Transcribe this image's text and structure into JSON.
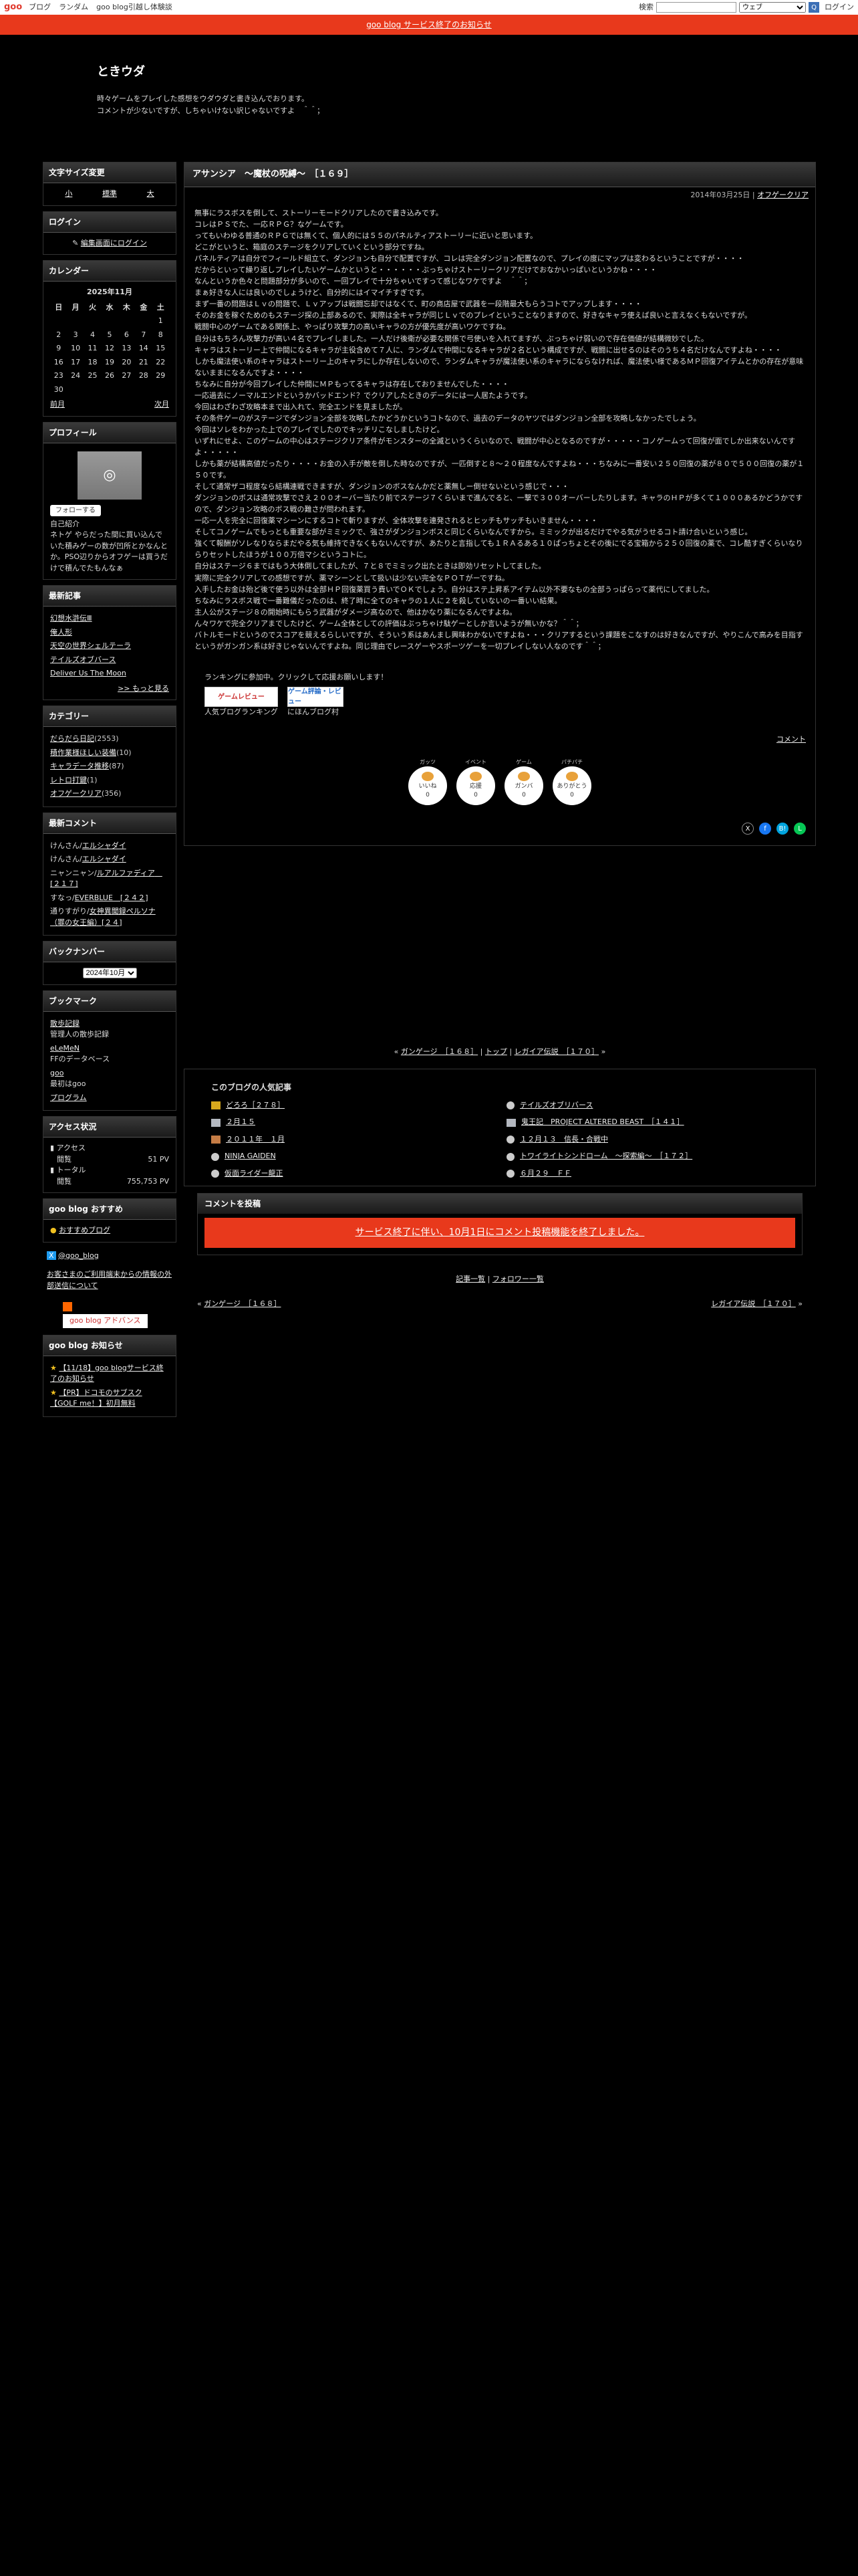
{
  "topbar": {
    "logo": "goo",
    "nav": [
      "ブログ",
      "ランダム",
      "goo blog引越し体験談"
    ],
    "search_label": "検索",
    "search_select": "ウェブ",
    "search_button": "Q",
    "login": "ログイン"
  },
  "notice": {
    "text": "goo blog サービス終了のお知らせ"
  },
  "header": {
    "title": "ときウダ",
    "desc1": "時々ゲームをプレイした感想をウダウダと書き込んでおります。",
    "desc2": "コメントが少ないですが、しちゃいけない訳じゃないですよ　＾＾；"
  },
  "sidebar": {
    "font_title": "文字サイズ変更",
    "font_small": "小",
    "font_mid": "標準",
    "font_large": "大",
    "login_title": "ログイン",
    "login_link": "編集画面にログイン",
    "cal_title": "カレンダー",
    "cal_month": "2025年11月",
    "cal_days": [
      "日",
      "月",
      "火",
      "水",
      "木",
      "金",
      "土"
    ],
    "cal_rows": [
      [
        "",
        "",
        "",
        "",
        "",
        "",
        "1"
      ],
      [
        "2",
        "3",
        "4",
        "5",
        "6",
        "7",
        "8"
      ],
      [
        "9",
        "10",
        "11",
        "12",
        "13",
        "14",
        "15"
      ],
      [
        "16",
        "17",
        "18",
        "19",
        "20",
        "21",
        "22"
      ],
      [
        "23",
        "24",
        "25",
        "26",
        "27",
        "28",
        "29"
      ],
      [
        "30",
        "",
        "",
        "",
        "",
        "",
        ""
      ]
    ],
    "cal_prev": "前月",
    "cal_next": "次月",
    "profile_title": "プロフィール",
    "follow": "フォローする",
    "profile_label": "自己紹介",
    "profile_text": "ネトゲ やらだった間に買い込んでいた積みゲーの数が凹所とかなんとか。PSO辺りからオフゲーは買うだけで積んでたもんなぁ",
    "recent_title": "最新記事",
    "recent": [
      "幻想水滸伝Ⅲ",
      "俺人形",
      "天空の世界シェルテーラ",
      "テイルズオブバース",
      "Deliver Us The Moon"
    ],
    "recent_more": ">> もっと見る",
    "cat_title": "カテゴリー",
    "categories": [
      {
        "name": "だらだら日記",
        "count": "(2553)"
      },
      {
        "name": "積作業様ほしい装備",
        "count": "(10)"
      },
      {
        "name": "キャラデータ推移",
        "count": "(87)"
      },
      {
        "name": "レトロ打鍵",
        "count": "(1)"
      },
      {
        "name": "オフゲークリア",
        "count": "(356)"
      }
    ],
    "comments_title": "最新コメント",
    "comments": [
      {
        "who": "けんさん",
        "post": "エルシャダイ"
      },
      {
        "who": "けんさん",
        "post": "エルシャダイ"
      },
      {
        "who": "ニャンニャン",
        "post": "ルアルファディア　[２１７]"
      },
      {
        "who": "すなっ",
        "post": "EVERBLUE　[２４２]"
      },
      {
        "who": "通りすがり",
        "post": "女神異聞録ペルソナ（罪の女王編）[２４]"
      }
    ],
    "backnumber_title": "バックナンバー",
    "backnumber_value": "2024年10月",
    "bookmark_title": "ブックマーク",
    "bookmarks": [
      {
        "name": "散歩記録",
        "desc": "管理人の散歩記録"
      },
      {
        "name": "eLeMeN",
        "desc": "FFのデータベース"
      },
      {
        "name": "goo",
        "desc": "最初はgoo"
      },
      {
        "name": "プログラム",
        "desc": ""
      }
    ],
    "access_title": "アクセス状況",
    "access_label": "アクセス",
    "access_view": "閲覧",
    "access_view_count": "51 PV",
    "total_label": "トータル",
    "total_view": "閲覧",
    "total_view_count": "755,753 PV",
    "recommend_title": "goo blog おすすめ",
    "recommend_link": "おすすめブログ",
    "x_link": "@goo_blog",
    "external": "お客さまのご利用端末からの情報の外部送信について",
    "advance": "goo blog アドバンス",
    "news_title": "goo blog お知らせ",
    "news": [
      "【11/18】goo blogサービス終了のお知らせ",
      "【PR】ドコモのサブスク【GOLF me！】初月無料"
    ]
  },
  "entry": {
    "title": "アサンシア　～魔杖の呪縛～　［１６９］",
    "date": "2014年03月25日",
    "category": "オフゲークリア",
    "body": [
      "無事にラスボスを倒して、ストーリーモードクリアしたので書き込みです。",
      "コレはＰＳでた、一応ＲＰＧ？なゲームです。",
      "ってもいわゆる普通のＲＰＧでは無くて、個人的には５５のパネルティアストーリーに近いと思います。",
      "どこがというと、箱庭のステージをクリアしていくという部分ですね。",
      "パネルティアは自分でフィールド組立て、ダンジョンも自分で配置ですが、コレは完全ダンジョン配置なので、プレイの度にマップは変わるということですが・・・・",
      "だからといって繰り返しプレイしたいゲームかというと・・・・・・ぶっちゃけストーリークリアだけでおなかいっぱいというかね・・・・",
      "なんというか色々と問題部分が多いので、一回プレイで十分ちゃいですって感じなワケですよ　＾＾；",
      "まぁ好きな人には良いのでしょうけど、自分的にはイマイチすぎです。",
      "まず一番の問題はＬｖの問題で、Ｌｖアップは戦闘忘却ではなくて、町の商店屋で武器を一段階最大もらうコトでアップします・・・・",
      "そのお金を稼ぐためのもステージ探の上部あるので、実際は全キャラが同じＬｖでのプレイということなりますので、好きなキャラ使えば良いと言えなくもないですが。",
      "戦闘中心のゲームである関係上、やっぱり攻撃力の高いキャラの方が優先度が高いワケですね。",
      "自分はもちろん攻撃力が高い４名でプレイしました。一人だけ後衛が必要な関係で弓使いを入れてますが、ぶっちゃけ弱いので存在価値が結構微妙でした。",
      "キャラはストーリー上で仲間になるキャラが主役含めて７人に、ランダムで仲間になるキャラが２名という構成ですが、戦闘に出せるのはそのうち４名だけなんですよね・・・・",
      "しかも魔法使い系のキャラはストーリー上のキャラにしか存在しないので、ランダムキャラが魔法使い系のキャラにならなければ、魔法使い様であるＭＰ回復アイテムとかの存在が意味ないままになるんですよ・・・・",
      "ちなみに自分が今回プレイした仲間にＭＰもってるキャラは存在しておりませんでした・・・・",
      "一応過去にノーマルエンドというかバッドエンド？でクリアしたときのデータには一人居たようです。",
      "今回はわざわざ攻略本まで出入れて、完全エンドを見ましたが。",
      "その条件ゲーのがステージでダンジョン全部を攻略したかどうかというコトなので、過去のデータのヤツではダンジョン全部を攻略しなかったでしょう。",
      "今回はソレをわかった上でのプレイでしたのでキッチリこなしましたけど。",
      "いずれにせよ、このゲームの中心はステージクリア条件がモンスターの全滅というくらいなので、戦闘が中心となるのですが・・・・・コノゲームって回復が面でしか出来ないんですよ・・・・・",
      "しかも薬が結構高値だったり・・・・お金の入手が敵を倒した時なのですが、一匹倒すと８～２０程度なんですよね・・・ちなみに一番安い２５０回復の薬が８０で５００回復の薬が１５０です。",
      "そして通常ザコ程度なら結構連戦できますが、ダンジョンのボスなんかだと薬無しー倒せないという感じで・・・",
      "ダンジョンのボスは通常攻撃でさえ２００オーバー当たり前でステージ７くらいまで進んでると、一撃で３００オーバーしたりします。キャラのＨＰが多くて１０００あるかどうかですので、ダンジョン攻略のボス戦の難さが問われます。",
      "一応一人を完全に回復薬マシーンにするコトで斬りますが、全体攻撃を連発されるとヒッチもサッチもいきません・・・・",
      "そしてコノゲームでもっとも重要な部がミミックで、強さがダンジョンボスと同じくらいなんですから。ミミックが出るだけでやる気がうせるコト請け合いという感じ。",
      "強くて報酬がソレなりならまだやる気も維持できなくもないんですが、あたりと言指しても１ＲＡるある１０ぱっちょとその後にでる宝箱から２５０回復の薬で、コレ酷すぎくらいなりらりセットしたほうが１００万倍マシというコトに。",
      "自分はステージ６まではもう大体倒してましたが、７と８でミミック出たときは即効リセットしてました。",
      "実際に完全クリアしての感想ですが、薬マシーンとして扱いは少ない完全なＰＯＴがーですね。",
      "入手したお金は殆ど後で使う以外は全部ＨＰ回復薬買う費いでＯＫでしょう。自分はステ上昇系アイテム以外不要なもの全部うっぱらって薬代にしてました。",
      "ちなみにラスボス戦で一番難儀だったのは、終了時に全てのキャラの１人に２を殺していないの一番いい結果。",
      "主人公がステージ８の開始時にもらう武器がダメージ高なので、他はかなり薬になるんですよね。",
      "ん々ワケで完全クリアまでしたけど、ゲーム全体としての評価はぶっちゃけ駄ゲーとしか言いようが無いかな？＾＾；",
      "バトルモードというのでスコアを競えるらしいですが、そういう系はあんまし興味わかないですよね・・・クリアするという課題をこなすのは好きなんですが、やりこんで高みを目指すというがガンガン系は好きじゃないんですよね。同じ理由でレースゲーやスポーツゲーを一切プレイしない人なのです＾＾；"
    ],
    "banner_caption": "ランキングに参加中。クリックして応援お願いします！",
    "banner1_img": "ゲームレビュー",
    "banner1": "人気ブログランキング",
    "banner2_img": "ゲーム評論・レビュー",
    "banner2": "にほんブログ村",
    "comment_link": "コメント",
    "reactions": [
      {
        "top": "ガッツ",
        "label": "いいね",
        "count": "0"
      },
      {
        "top": "イベント",
        "label": "応援",
        "count": "0"
      },
      {
        "top": "ゲーム",
        "label": "ガンバ",
        "count": "0"
      },
      {
        "top": "パチパチ",
        "label": "ありがとう",
        "count": "0"
      }
    ],
    "share": [
      "X",
      "f",
      "B!",
      "L"
    ]
  },
  "pager": {
    "prev": "ガンゲージ　［１６８］",
    "top": "トップ",
    "next": "レガイア伝説　［１７０］"
  },
  "popular": {
    "title": "このブログの人気記事",
    "items": [
      "どろろ［２７８］",
      "テイルズオブリバース",
      "２月１５",
      "鬼王記　PROJECT ALTERED BEAST　［１４１］",
      "２０１１年　１月",
      "１２月１３　信長・合戦中",
      "NINJA GAIDEN",
      "トワイライトシンドローム　～探索編～　［１７２］",
      "仮面ライダー龍正",
      "６月２９　ＦＦ"
    ]
  },
  "comment_post": {
    "title": "コメントを投稿",
    "closed": "サービス終了に伴い、10月1日にコメント投稿機能を終了しました。"
  },
  "footer_links": {
    "list": "記事一覧",
    "follower": "フォロワー一覧"
  },
  "prevnext": {
    "prev": "ガンゲージ　［１６８］",
    "next": "レガイア伝説　［１７０］"
  }
}
